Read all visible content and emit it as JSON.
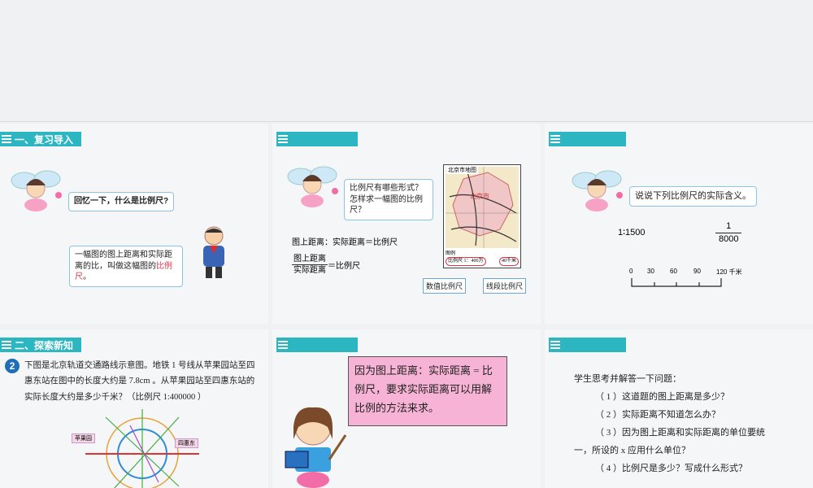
{
  "slides": {
    "s1": {
      "section": "一、复习导入",
      "q": "回忆一下，什么是比例尺?",
      "answer_prefix": "一幅图的图上距离和实际距离的比，叫做这幅图的",
      "answer_key": "比例尺",
      "answer_suffix": "。"
    },
    "s2": {
      "bubble_l1": "比例尺有哪些形式？",
      "bubble_l2": "怎样求一幅图的比例尺？",
      "formula1": "图上距离：实际距离＝比例尺",
      "frac_num": "图上距离",
      "frac_den": "实际距离",
      "frac_eq": "＝比例尺",
      "map_title": "北京市地图",
      "map_city": "北京市",
      "map_legend": "图例",
      "map_scale_text": "比例尺 1：400万",
      "map_km": "40千米",
      "label_num": "数值比例尺",
      "label_seg": "线段比例尺"
    },
    "s3": {
      "bubble": "说说下列比例尺的实际含义。",
      "ratio": "1∶1500",
      "frac_num": "1",
      "frac_den": "8000",
      "ticks": [
        "0",
        "30",
        "60",
        "90",
        "120 千米"
      ]
    },
    "s4": {
      "section": "二、探索新知",
      "badge": "2",
      "problem": "下图是北京轨道交通路线示意图。地铁 1 号线从苹果园站至四惠东站在图中的长度大约是 7.8cm 。从苹果园站至四惠东站的实际长度大约是多少千米？（比例尺 1:400000 ）",
      "tag1": "苹果园",
      "tag2": "四惠东"
    },
    "s5": {
      "text": "因为图上距离：实际距离 = 比例尺，要求实际距离可以用解比例的方法来求。"
    },
    "s6": {
      "intro": "学生思考并解答一下问题：",
      "q1": "（ 1 ）这道题的图上距离是多少？",
      "q2": "（ 2 ）实际距离不知道怎么办？",
      "q3a": "（ 3 ）因为图上距离和实际距离的单位要统",
      "q3b": "一，所设的 x 应用什么单位？",
      "q4": "（ 4 ）比例尺是多少？写成什么形式？"
    }
  },
  "colors": {
    "band": "#2bb6c1",
    "pink": "#f7b3d5",
    "accent_red": "#e0344a"
  }
}
